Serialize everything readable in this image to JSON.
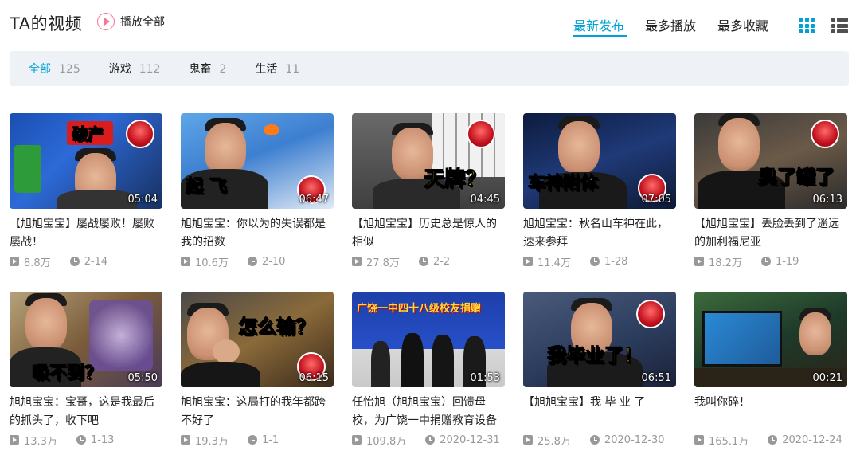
{
  "header": {
    "title": "TA的视频",
    "play_all": "播放全部",
    "sort_options": [
      "最新发布",
      "最多播放",
      "最多收藏"
    ],
    "active_sort": "最新发布"
  },
  "filters": [
    {
      "name": "全部",
      "count": "125",
      "active": true
    },
    {
      "name": "游戏",
      "count": "112",
      "active": false
    },
    {
      "name": "鬼畜",
      "count": "2",
      "active": false
    },
    {
      "name": "生活",
      "count": "11",
      "active": false
    }
  ],
  "videos": [
    {
      "title": "【旭旭宝宝】屡战屡败！屡败屡战！",
      "duration": "05:04",
      "views": "8.8万",
      "date": "2-14",
      "overlay": "破产"
    },
    {
      "title": "旭旭宝宝：你以为的失误都是我的招数",
      "duration": "06:47",
      "views": "10.6万",
      "date": "2-10",
      "overlay": "起 飞"
    },
    {
      "title": "【旭旭宝宝】历史总是惊人的相似",
      "duration": "04:45",
      "views": "27.8万",
      "date": "2-2",
      "overlay": "天牌？"
    },
    {
      "title": "旭旭宝宝：秋名山车神在此，速来参拜",
      "duration": "07:05",
      "views": "11.4万",
      "date": "1-28",
      "overlay": "车神附体"
    },
    {
      "title": "【旭旭宝宝】丢脸丢到了遥远的加利福尼亚",
      "duration": "06:13",
      "views": "18.2万",
      "date": "1-19",
      "overlay": "臭了罐了"
    },
    {
      "title": "旭旭宝宝：宝哥，这是我最后的抓头了，收下吧",
      "duration": "05:50",
      "views": "13.3万",
      "date": "1-13",
      "overlay": "吸不到？"
    },
    {
      "title": "旭旭宝宝：这局打的我年都跨不好了",
      "duration": "06:15",
      "views": "19.3万",
      "date": "1-1",
      "overlay": "怎么输？"
    },
    {
      "title": "任怡旭（旭旭宝宝）回馈母校，为广饶一中捐赠教育设备",
      "duration": "01:53",
      "views": "109.8万",
      "date": "2020-12-31",
      "overlay": "广饶一中四十八级校友捐赠"
    },
    {
      "title": "【旭旭宝宝】我 毕 业 了",
      "duration": "06:51",
      "views": "25.8万",
      "date": "2020-12-30",
      "overlay": "我毕业了！"
    },
    {
      "title": "我叫你碎！",
      "duration": "00:21",
      "views": "165.1万",
      "date": "2020-12-24",
      "overlay": ""
    }
  ],
  "colors": {
    "accent": "#00a1d6",
    "pink": "#fb7299",
    "muted": "#999999",
    "filter_bg": "#eef2f7"
  }
}
